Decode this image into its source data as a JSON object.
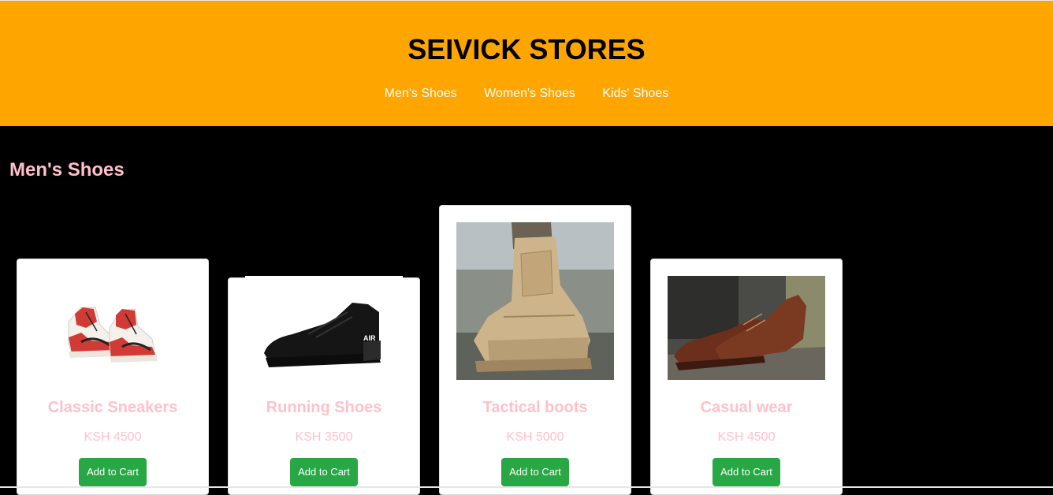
{
  "header": {
    "title": "SEIVICK STORES",
    "nav": [
      "Men's Shoes",
      "Women's Shoes",
      "Kids' Shoes"
    ]
  },
  "section": {
    "title": "Men's Shoes"
  },
  "products": [
    {
      "name": "Classic Sneakers",
      "price": "KSH 4500",
      "button": "Add to Cart",
      "image": "red-white-high-top-sneakers"
    },
    {
      "name": "Running Shoes",
      "price": "KSH 3500",
      "button": "Add to Cart",
      "image": "black-running-shoe"
    },
    {
      "name": "Tactical boots",
      "price": "KSH 5000",
      "button": "Add to Cart",
      "image": "tan-tactical-boot"
    },
    {
      "name": "Casual wear",
      "price": "KSH 4500",
      "button": "Add to Cart",
      "image": "brown-leather-casual-shoe"
    }
  ],
  "colors": {
    "header_bg": "#ffa500",
    "page_bg": "#000000",
    "accent_pink": "#ffc0cb",
    "button_green": "#28a745"
  }
}
